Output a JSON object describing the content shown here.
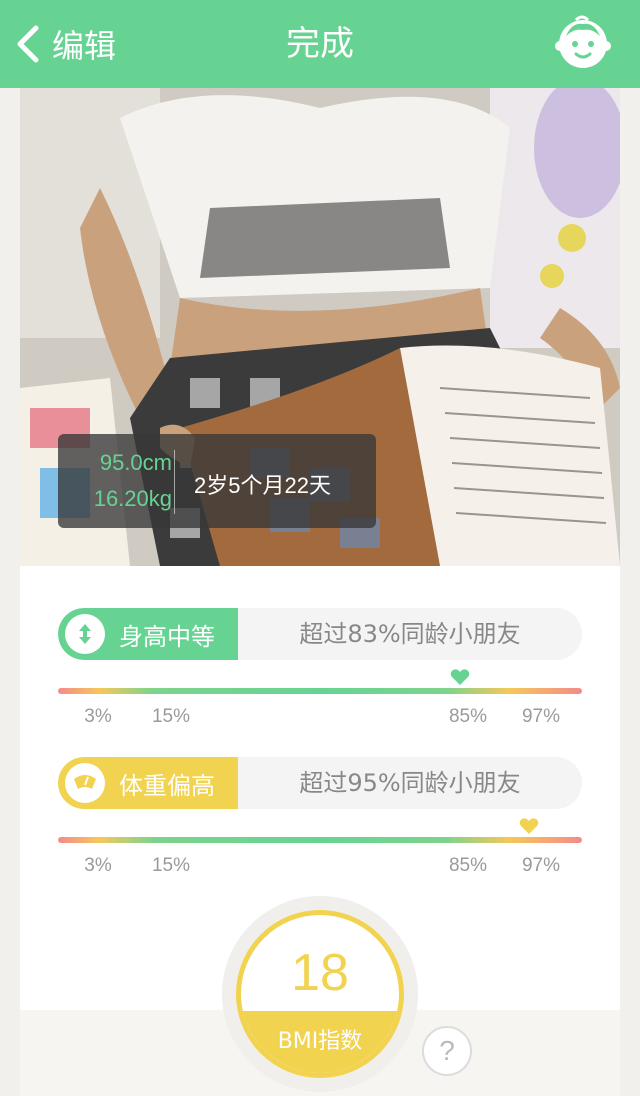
{
  "navbar": {
    "back_label": "编辑",
    "title": "完成",
    "avatar_icon": "baby-face-icon",
    "color": "#66d393"
  },
  "photo": {
    "overlay": {
      "height": "95.0cm",
      "weight": "16.20kg",
      "age": "2岁5个月22天"
    }
  },
  "height_metric": {
    "icon": "up-down-arrow-icon",
    "tag": "身高中等",
    "description": "超过83%同龄小朋友",
    "color": "#66d393",
    "percentile": 83,
    "ticks": [
      "3%",
      "15%",
      "85%",
      "97%"
    ]
  },
  "weight_metric": {
    "icon": "scale-icon",
    "tag": "体重偏高",
    "description": "超过95%同龄小朋友",
    "color": "#f1d34f",
    "percentile": 95,
    "ticks": [
      "3%",
      "15%",
      "85%",
      "97%"
    ]
  },
  "bmi": {
    "value": "18",
    "label": "BMI指数",
    "help": "?"
  }
}
